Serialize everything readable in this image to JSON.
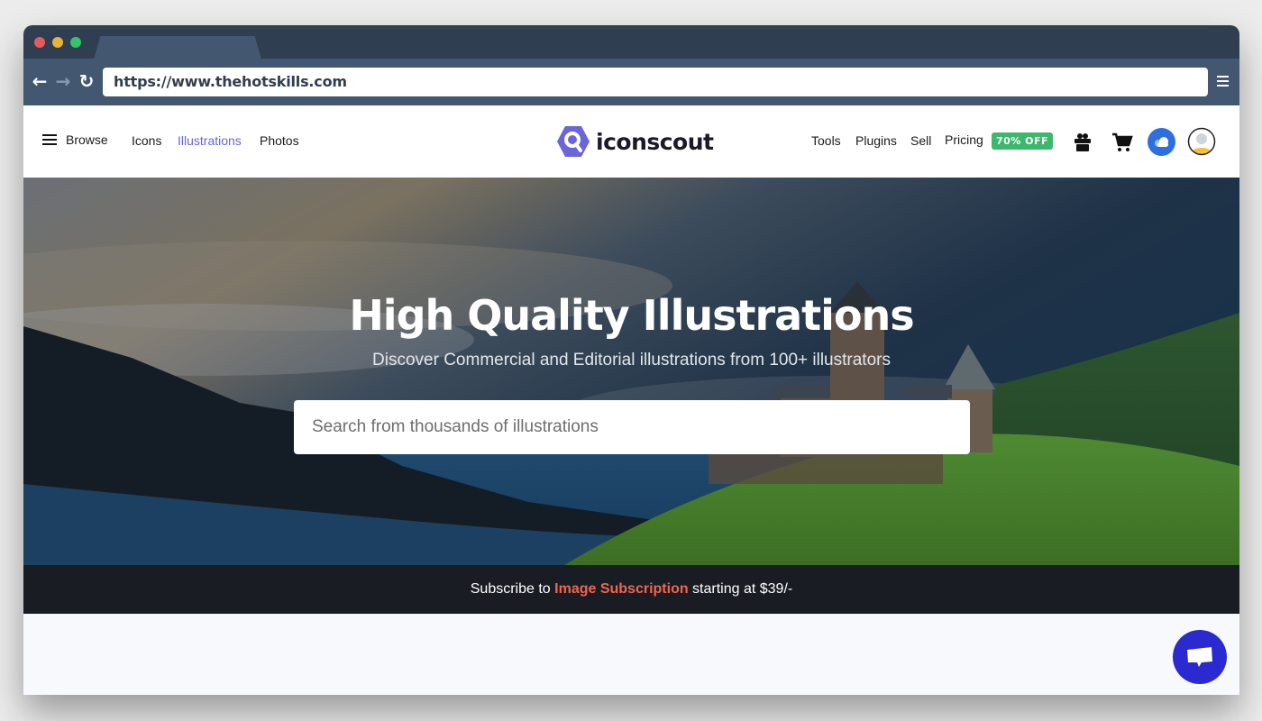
{
  "browser": {
    "url": "https://www.thehotskills.com",
    "colors": {
      "titlebar": "#2f3e50",
      "toolbar": "#435870"
    }
  },
  "header": {
    "browse_label": "Browse",
    "nav_left": [
      {
        "label": "Icons",
        "active": false
      },
      {
        "label": "Illustrations",
        "active": true
      },
      {
        "label": "Photos",
        "active": false
      }
    ],
    "logo_text": "iconscout",
    "nav_right": [
      {
        "label": "Tools"
      },
      {
        "label": "Plugins"
      },
      {
        "label": "Sell"
      },
      {
        "label": "Pricing"
      }
    ],
    "pricing_badge": "70% OFF",
    "icons": [
      "gift-icon",
      "cart-icon",
      "cloud-icon",
      "avatar-icon"
    ],
    "colors": {
      "accent": "#6a66d9",
      "badge": "#3bb86b",
      "logo": "#6a66d9"
    }
  },
  "hero": {
    "title": "High Quality Illustrations",
    "subtitle": "Discover Commercial and Editorial illustrations from 100+ illustrators",
    "search_placeholder": "Search from thousands of illustrations"
  },
  "promo": {
    "prefix": "Subscribe to ",
    "highlight": "Image Subscription",
    "suffix": " starting at $39/-",
    "colors": {
      "background": "#1a1c24",
      "highlight": "#f0654d"
    }
  },
  "chat": {
    "icon": "chat-icon",
    "color": "#2a2ad0"
  }
}
